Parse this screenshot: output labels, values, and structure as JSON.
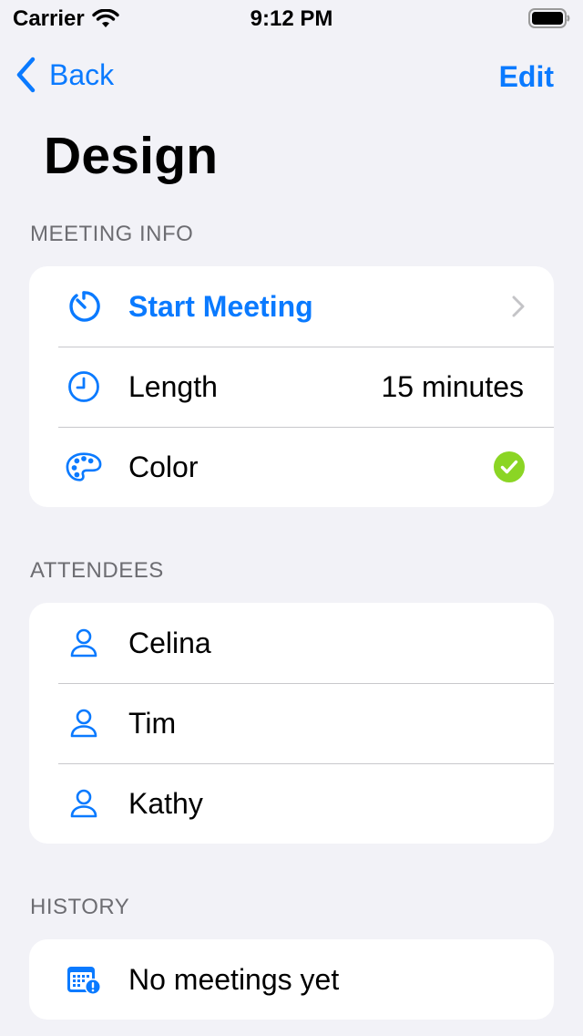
{
  "status": {
    "carrier": "Carrier",
    "time": "9:12 PM"
  },
  "nav": {
    "back_label": "Back",
    "edit_label": "Edit"
  },
  "page": {
    "title": "Design"
  },
  "meeting_info": {
    "header": "MEETING INFO",
    "start_label": "Start Meeting",
    "length_label": "Length",
    "length_value": "15 minutes",
    "color_label": "Color",
    "color_swatch": "#8bd524"
  },
  "attendees": {
    "header": "ATTENDEES",
    "items": [
      {
        "name": "Celina",
        "icon": "person-icon"
      },
      {
        "name": "Tim",
        "icon": "person-icon"
      },
      {
        "name": "Kathy",
        "icon": "person-icon"
      }
    ]
  },
  "history": {
    "header": "HISTORY",
    "empty_label": "No meetings yet",
    "icon": "calendar-alert-icon"
  },
  "colors": {
    "accent": "#0a7aff",
    "background": "#f2f2f7",
    "secondary_text": "#6d6d72"
  }
}
